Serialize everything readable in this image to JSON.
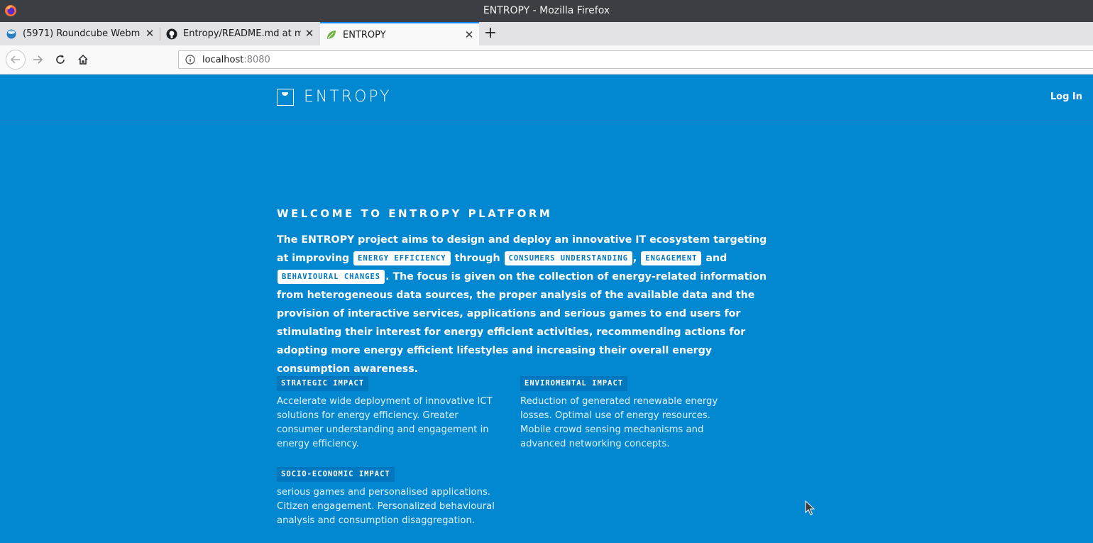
{
  "window": {
    "title": "ENTROPY - Mozilla Firefox"
  },
  "tabs": [
    {
      "label": "(5971) Roundcube Webma",
      "icon": "roundcube-icon",
      "active": false
    },
    {
      "label": "Entropy/README.md at m",
      "icon": "github-icon",
      "active": false
    },
    {
      "label": "ENTROPY",
      "icon": "spring-leaf-icon",
      "active": true
    }
  ],
  "navbar": {
    "url_host": "localhost",
    "url_port": ":8080"
  },
  "site": {
    "brand": "ENTROPY",
    "login": "Log In"
  },
  "main": {
    "heading": "WELCOME TO ENTROPY PLATFORM",
    "intro": {
      "part1": "The ENTROPY project aims to design and deploy an innovative IT ecosystem targeting at improving ",
      "tag1": "ENERGY EFFICIENCY",
      "part2": " through ",
      "tag2": "CONSUMERS UNDERSTANDING",
      "part3": ", ",
      "tag3": "ENGAGEMENT",
      "part4": " and ",
      "tag4": "BEHAVIOURAL CHANGES",
      "part5": ". The focus is given on the collection of energy-related information from heterogeneous data sources, the proper analysis of the available data and the provision of interactive services, applications and serious games to end users for stimulating their interest for energy efficient activities, recommending actions for adopting more energy efficient lifestyles and increasing their overall energy consumption awareness."
    },
    "impacts": [
      {
        "label": "STRATEGIC IMPACT",
        "desc": "Accelerate wide deployment of innovative ICT solutions for energy efficiency. Greater consumer understanding and engagement in energy efficiency."
      },
      {
        "label": "ENVIROMENTAL IMPACT",
        "desc": "Reduction of generated renewable energy losses. Optimal use of energy resources. Mobile crowd sensing mechanisms and advanced networking concepts."
      },
      {
        "label": "SOCIO-ECONOMIC IMPACT",
        "desc": "serious games and personalised applications. Citizen engagement. Personalized behavioural analysis and consumption disaggregation."
      }
    ]
  },
  "colors": {
    "page_bg": "#0288d1",
    "accent": "#0a84ff",
    "tag_text": "#0277bd",
    "impact_label_bg": "#0277bd"
  }
}
